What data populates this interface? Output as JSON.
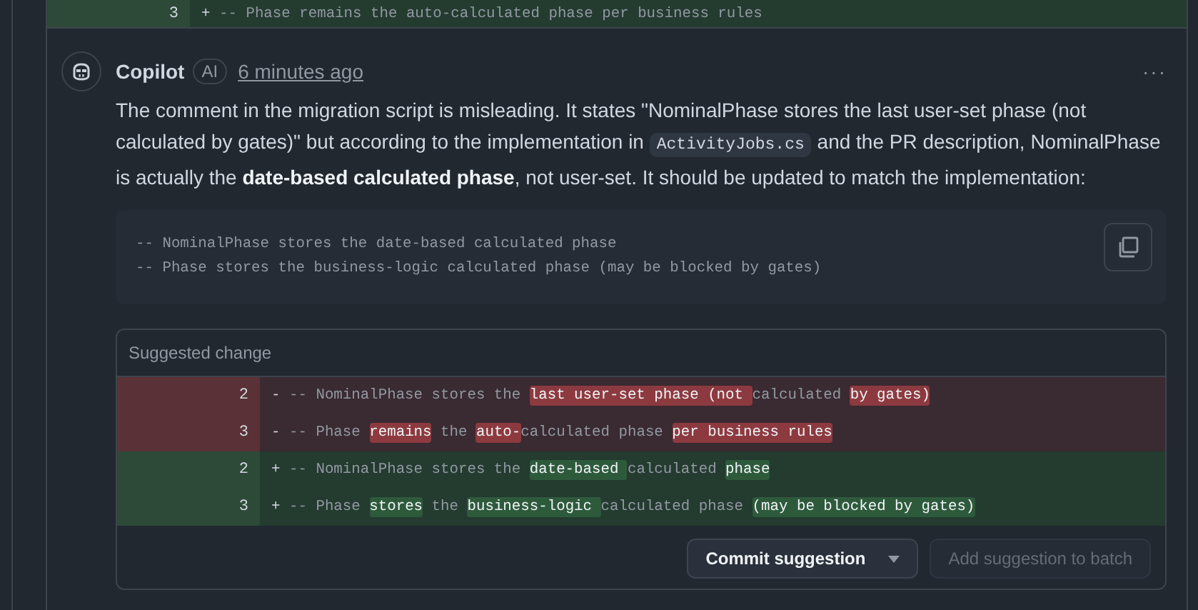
{
  "previous_diff_line": {
    "kind": "addition",
    "number": "3",
    "sign": "+",
    "segments": [
      {
        "text": "-- Phase remains the auto-calculated phase per business rules",
        "highlighted": false
      }
    ]
  },
  "comment": {
    "author": "Copilot",
    "badge": "AI",
    "time": "6 minutes ago",
    "menu": "···",
    "body": [
      {
        "kind": "text",
        "text": "The comment in the migration script is misleading. It states \"NominalPhase stores the last user-set phase (not calculated by gates)\" but according to the implementation in "
      },
      {
        "kind": "code",
        "text": "ActivityJobs.cs"
      },
      {
        "kind": "text",
        "text": " and the PR description, NominalPhase is actually the **date-based calculated phase**, not user-set. It should be updated to match the implementation:"
      }
    ],
    "code_lines": [
      "-- NominalPhase stores the date-based calculated phase",
      "-- Phase stores the business-logic calculated phase (may be blocked by gates)"
    ],
    "suggestion": {
      "title": "Suggested change",
      "lines": [
        {
          "kind": "deletion",
          "number": "2",
          "sign": "-",
          "segments": [
            {
              "text": "-- NominalPhase stores the ",
              "highlighted": false
            },
            {
              "text": "last user-set phase (not ",
              "highlighted": true
            },
            {
              "text": "calculated ",
              "highlighted": false
            },
            {
              "text": "by gates)",
              "highlighted": true
            }
          ]
        },
        {
          "kind": "deletion",
          "number": "3",
          "sign": "-",
          "segments": [
            {
              "text": "-- Phase ",
              "highlighted": false
            },
            {
              "text": "remains",
              "highlighted": true
            },
            {
              "text": " the ",
              "highlighted": false
            },
            {
              "text": "auto-",
              "highlighted": true
            },
            {
              "text": "calculated phase ",
              "highlighted": false
            },
            {
              "text": "per business rules",
              "highlighted": true
            }
          ]
        },
        {
          "kind": "addition",
          "number": "2",
          "sign": "+",
          "segments": [
            {
              "text": "-- NominalPhase stores the ",
              "highlighted": false
            },
            {
              "text": "date-based ",
              "highlighted": true
            },
            {
              "text": "calculated ",
              "highlighted": false
            },
            {
              "text": "phase",
              "highlighted": true
            }
          ]
        },
        {
          "kind": "addition",
          "number": "3",
          "sign": "+",
          "segments": [
            {
              "text": "-- Phase ",
              "highlighted": false
            },
            {
              "text": "stores",
              "highlighted": true
            },
            {
              "text": " the ",
              "highlighted": false
            },
            {
              "text": "business-logic ",
              "highlighted": true
            },
            {
              "text": "calculated phase ",
              "highlighted": false
            },
            {
              "text": "(may be blocked by gates)",
              "highlighted": true
            }
          ]
        }
      ],
      "buttons": [
        {
          "label": "Commit suggestion",
          "disabled": false,
          "dropdown": true
        },
        {
          "label": "Add suggestion to batch",
          "disabled": true,
          "dropdown": false
        }
      ]
    }
  }
}
